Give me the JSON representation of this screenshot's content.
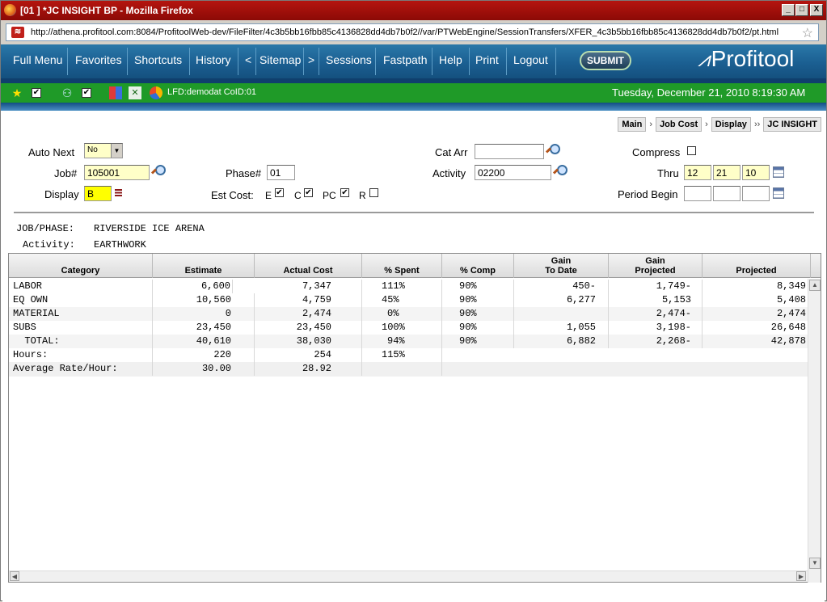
{
  "window": {
    "title": "[01 ] *JC INSIGHT BP - Mozilla Firefox",
    "min": "_",
    "max": "□",
    "close": "X"
  },
  "browser": {
    "url": "http://athena.profitool.com:8084/ProfitoolWeb-dev/FileFilter/4c3b5bb16fbb85c4136828dd4db7b0f2//var/PTWebEngine/SessionTransfers/XFER_4c3b5bb16fbb85c4136828dd4db7b0f2/pt.html"
  },
  "nav": {
    "items": [
      "Full Menu",
      "Favorites",
      "Shortcuts",
      "History",
      "<",
      "Sitemap",
      ">",
      "Sessions",
      "Fastpath",
      "Help",
      "Print",
      "Logout"
    ],
    "submit": "SUBMIT",
    "logo": "Profitool"
  },
  "status": {
    "lfd": "LFD:demodat CoID:01",
    "datetime": "Tuesday, December 21, 2010 8:19:30 AM"
  },
  "breadcrumb": [
    "Main",
    "Job Cost",
    "Display",
    "JC INSIGHT"
  ],
  "breadcrumb_seps": [
    "›",
    "›",
    "››"
  ],
  "form": {
    "auto_next_label": "Auto Next",
    "auto_next_value": "No",
    "job_label": "Job#",
    "job_value": "105001",
    "display_label": "Display",
    "display_value": "B",
    "phase_label": "Phase#",
    "phase_value": "01",
    "est_cost_label": "Est Cost:",
    "est_cost_e": "E",
    "est_cost_c": "C",
    "est_cost_pc": "PC",
    "est_cost_r": "R",
    "cat_arr_label": "Cat Arr",
    "cat_arr_value": "",
    "activity_label": "Activity",
    "activity_value": "02200",
    "compress_label": "Compress",
    "thru_label": "Thru",
    "thru_month": "12",
    "thru_day": "21",
    "thru_year": "10",
    "period_begin_label": "Period Begin"
  },
  "info": {
    "job_phase_label": "JOB/PHASE:",
    "job_phase_value": "RIVERSIDE ICE ARENA",
    "activity_label": "Activity:",
    "activity_value": "EARTHWORK"
  },
  "table": {
    "headers": [
      {
        "l1": "",
        "l2": "Category"
      },
      {
        "l1": "",
        "l2": "Estimate"
      },
      {
        "l1": "",
        "l2": "Actual Cost"
      },
      {
        "l1": "",
        "l2": "% Spent"
      },
      {
        "l1": "",
        "l2": "% Comp"
      },
      {
        "l1": "Gain",
        "l2": "To Date"
      },
      {
        "l1": "Gain",
        "l2": "Projected"
      },
      {
        "l1": "",
        "l2": "Projected"
      }
    ],
    "rows": [
      [
        "LABOR",
        "6,600",
        "7,347",
        "111%",
        "90%",
        "450-",
        "1,749-",
        "8,349"
      ],
      [
        "EQ OWN",
        "10,560",
        "4,759",
        "45%",
        "90%",
        "6,277",
        "5,153",
        "5,408"
      ],
      [
        "MATERIAL",
        "0",
        "2,474",
        "0%",
        "90%",
        "",
        "2,474-",
        "2,474"
      ],
      [
        "SUBS",
        "23,450",
        "23,450",
        "100%",
        "90%",
        "1,055",
        "3,198-",
        "26,648"
      ],
      [
        "  TOTAL:",
        "40,610",
        "38,030",
        "94%",
        "90%",
        "6,882",
        "2,268-",
        "42,878"
      ]
    ],
    "hours": [
      "Hours:",
      "220",
      "254",
      "115%"
    ],
    "avg_rate": [
      "Average Rate/Hour:",
      "30.00",
      "28.92"
    ]
  }
}
